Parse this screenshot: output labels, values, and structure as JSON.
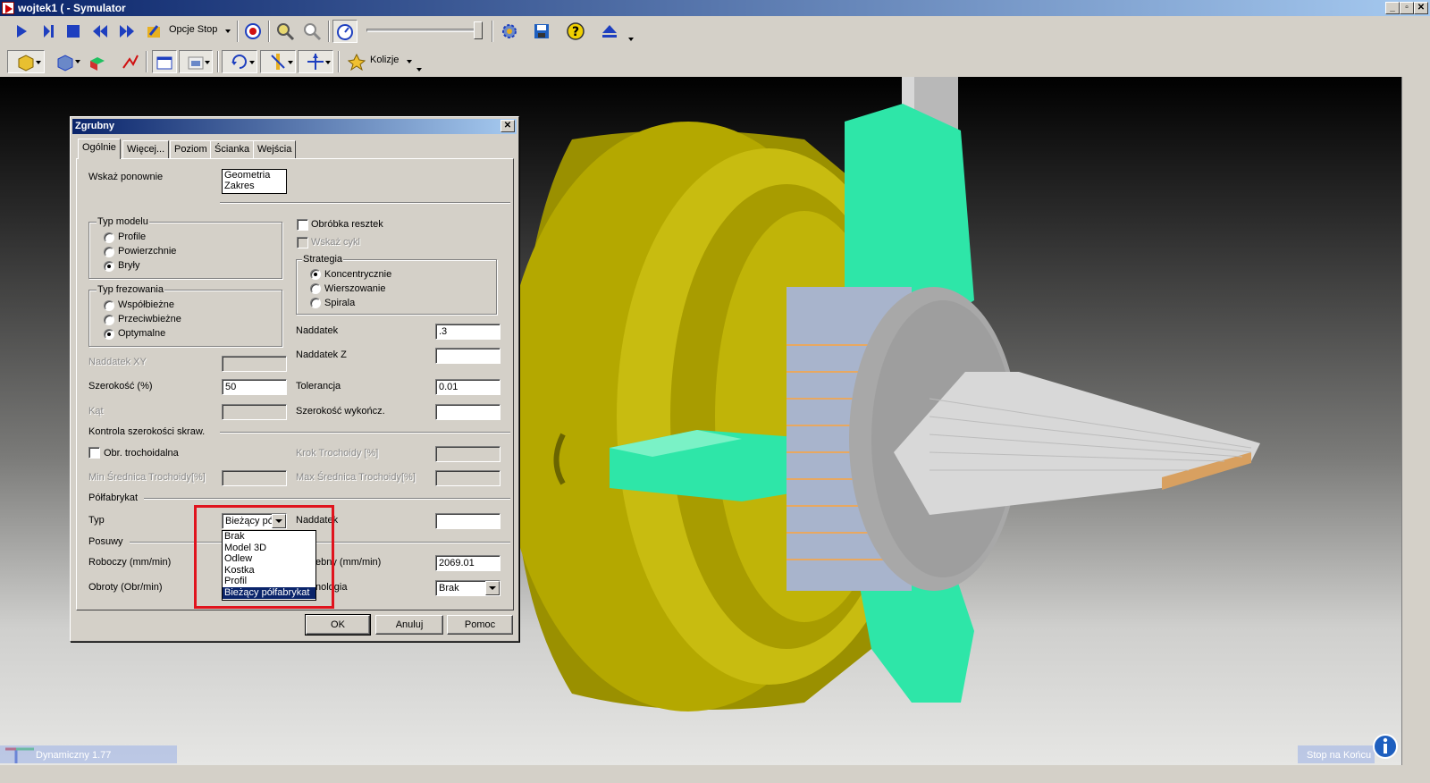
{
  "window": {
    "title": "wojtek1 ( - Symulator"
  },
  "toolbar1": {
    "opcje_stop_label": "Opcje Stop"
  },
  "toolbar2": {
    "kolizje_label": "Kolizje"
  },
  "dialog": {
    "title": "Zgrubny",
    "tabs": [
      "Ogólnie",
      "Więcej...",
      "Poziom",
      "Ścianka",
      "Wejścia"
    ],
    "wskaz_ponownie": {
      "label": "Wskaż ponownie",
      "items": [
        "Geometria",
        "Zakres"
      ]
    },
    "typ_modelu": {
      "caption": "Typ modelu",
      "options": [
        "Profile",
        "Powierzchnie",
        "Bryły"
      ],
      "selected": "Bryły"
    },
    "typ_frezowania": {
      "caption": "Typ frezowania",
      "options": [
        "Współbieżne",
        "Przeciwbieżne",
        "Optymalne"
      ],
      "selected": "Optymalne"
    },
    "obrobka_resztek": "Obróbka resztek",
    "wskaz_cykl": "Wskaż cykl",
    "strategia": {
      "caption": "Strategia",
      "options": [
        "Koncentrycznie",
        "Wierszowanie",
        "Spirala"
      ],
      "selected": "Koncentrycznie"
    },
    "naddatek": {
      "label": "Naddatek",
      "value": ".3"
    },
    "naddatek_z": {
      "label": "Naddatek Z",
      "value": ""
    },
    "naddatek_xy": {
      "label": "Naddatek XY",
      "value": ""
    },
    "szerokosc": {
      "label": "Szerokość (%)",
      "value": "50"
    },
    "tolerancja": {
      "label": "Tolerancja",
      "value": "0.01"
    },
    "kat": {
      "label": "Kąt",
      "value": ""
    },
    "szerokosc_wykoncz": {
      "label": "Szerokość wykończ.",
      "value": ""
    },
    "kontrola_section": "Kontrola szerokości skraw.",
    "obr_trochoidalna": "Obr. trochoidalna",
    "krok_trochoidy": "Krok Trochoidy [%]",
    "min_srednica": "Min Średnica Trochoidy[%]",
    "max_srednica": "Max Średnica Trochoidy[%]",
    "polfabrykat_section": "Półfabrykat",
    "typ": {
      "label": "Typ",
      "value": "Bieżący pó"
    },
    "naddatek2": {
      "label": "Naddatek",
      "value": ""
    },
    "posuwy_section": "Posuwy",
    "roboczy": {
      "label": "Roboczy (mm/min)"
    },
    "posuw_right": {
      "label": "ebny (mm/min)",
      "value": "2069.01"
    },
    "obroty": {
      "label": "Obroty (Obr/min)"
    },
    "technologia": {
      "label": "nologia",
      "value": "Brak"
    },
    "dropdown_options": [
      "Brak",
      "Model 3D",
      "Odlew",
      "Kostka",
      "Profil",
      "Bieżący półfabrykat"
    ],
    "dropdown_selected_index": 5,
    "buttons": {
      "ok": "OK",
      "cancel": "Anuluj",
      "help": "Pomoc"
    }
  },
  "status": {
    "left": "Dynamiczny 1.77",
    "right": "Stop na Końcu"
  },
  "colors": {
    "title_bar": "#0a246a",
    "highlight": "#e0141e",
    "chuck": "#b4a800",
    "jaws": "#2ee6a8"
  }
}
